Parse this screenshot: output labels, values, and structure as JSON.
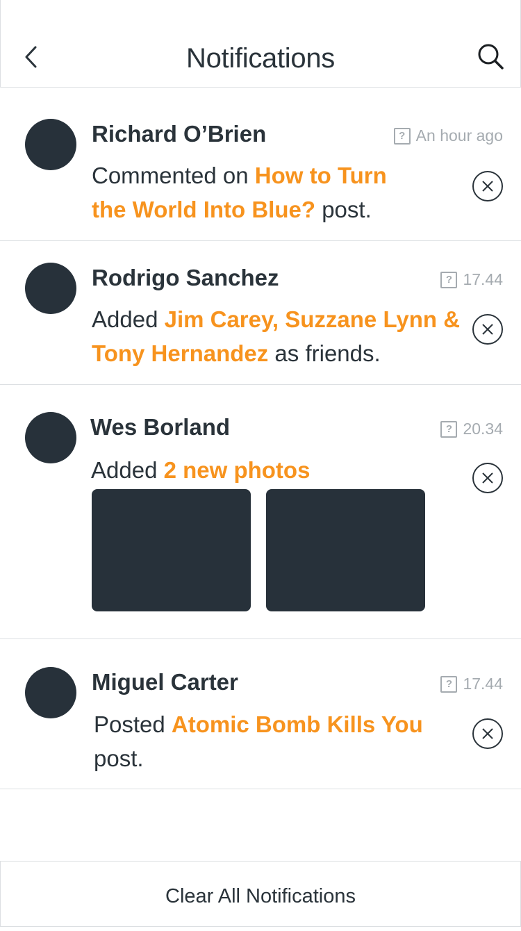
{
  "header": {
    "title": "Notifications"
  },
  "notifications": [
    {
      "name": "Richard O’Brien",
      "time": "An hour ago",
      "prefix": "Commented on ",
      "highlight": "How to Turn the World Into Blue?",
      "suffix": " post."
    },
    {
      "name": "Rodrigo Sanchez",
      "time": "17.44",
      "prefix": "Added ",
      "highlight": "Jim Carey, Suzzane Lynn & Tony Hernandez",
      "suffix": " as friends."
    },
    {
      "name": "Wes Borland",
      "time": "20.34",
      "prefix": "Added ",
      "highlight": "2 new photos",
      "suffix": ""
    },
    {
      "name": "Miguel Carter",
      "time": "17.44",
      "prefix": "Posted ",
      "highlight": "Atomic Bomb Kills You",
      "suffix": " post."
    }
  ],
  "footer": {
    "clear_label": "Clear All Notifications"
  },
  "icons": {
    "back": "chevron-left-icon",
    "search": "search-icon",
    "time": "question-box-icon",
    "dismiss": "close-icon"
  },
  "colors": {
    "accent": "#f7931e",
    "text": "#2a333a",
    "avatar": "#27313a",
    "muted": "#a5abb0",
    "divider": "#dcdfe2"
  }
}
